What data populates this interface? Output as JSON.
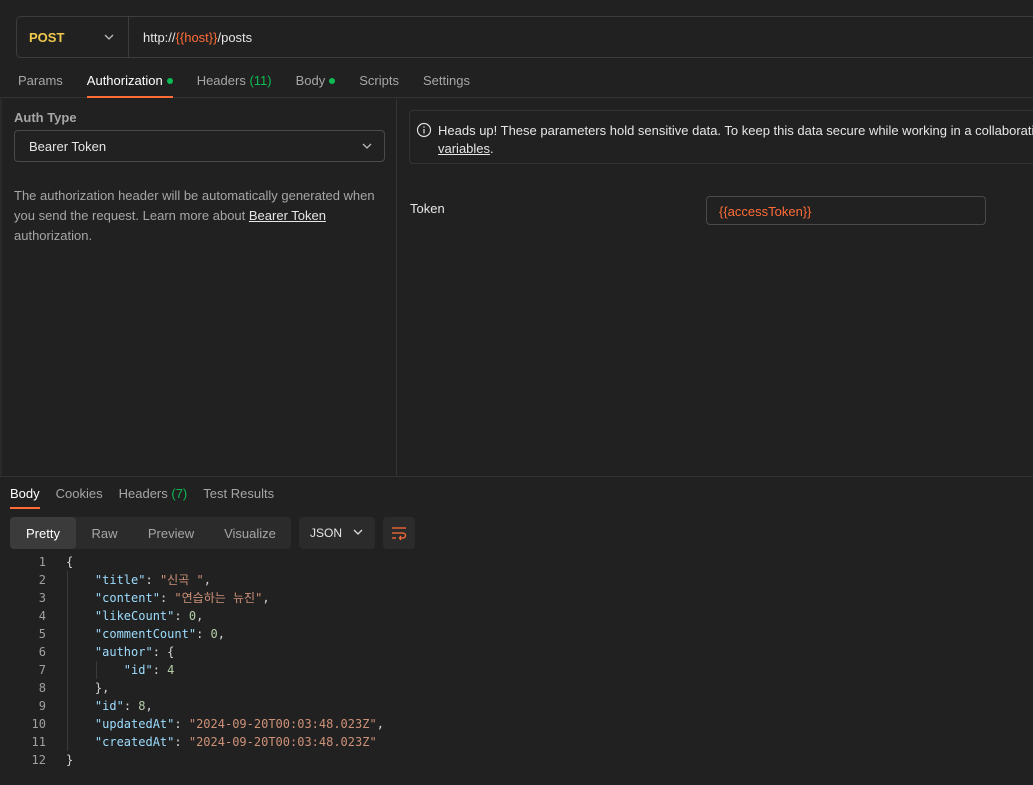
{
  "request": {
    "method": "POST",
    "url_prefix": "http://",
    "url_variable": "{{host}}",
    "url_suffix": "/posts"
  },
  "request_tabs": [
    {
      "label": "Params"
    },
    {
      "label": "Authorization",
      "dot": true
    },
    {
      "label": "Headers",
      "count": "(11)"
    },
    {
      "label": "Body",
      "dot": true
    },
    {
      "label": "Scripts"
    },
    {
      "label": "Settings"
    }
  ],
  "auth": {
    "type_label": "Auth Type",
    "type_value": "Bearer Token",
    "desc_pre": "The authorization header will be automatically generated when you send the request. Learn more about ",
    "desc_link": "Bearer Token",
    "desc_post": " authorization."
  },
  "alert": {
    "line1": "Heads up! These parameters hold sensitive data. To keep this data secure while working in a collaborative",
    "link": "variables",
    "line2_post": "."
  },
  "token": {
    "label": "Token",
    "value": "{{accessToken}}"
  },
  "response_tabs": [
    {
      "label": "Body"
    },
    {
      "label": "Cookies"
    },
    {
      "label": "Headers",
      "count": "(7)"
    },
    {
      "label": "Test Results"
    }
  ],
  "view_modes": [
    "Pretty",
    "Raw",
    "Preview",
    "Visualize"
  ],
  "format": "JSON",
  "response_lines": [
    {
      "num": "1",
      "text": "{"
    },
    {
      "num": "2",
      "text": "    \"title\": \"신곡 \","
    },
    {
      "num": "3",
      "text": "    \"content\": \"연습하는 뉴진\","
    },
    {
      "num": "4",
      "text": "    \"likeCount\": 0,"
    },
    {
      "num": "5",
      "text": "    \"commentCount\": 0,"
    },
    {
      "num": "6",
      "text": "    \"author\": {"
    },
    {
      "num": "7",
      "text": "        \"id\": 4"
    },
    {
      "num": "8",
      "text": "    },"
    },
    {
      "num": "9",
      "text": "    \"id\": 8,"
    },
    {
      "num": "10",
      "text": "    \"updatedAt\": \"2024-09-20T00:03:48.023Z\","
    },
    {
      "num": "11",
      "text": "    \"createdAt\": \"2024-09-20T00:03:48.023Z\""
    },
    {
      "num": "12",
      "text": "}"
    }
  ],
  "colors": {
    "accent": "#ff6c37",
    "method": "#f0c94d",
    "ok": "#0cbb52"
  }
}
